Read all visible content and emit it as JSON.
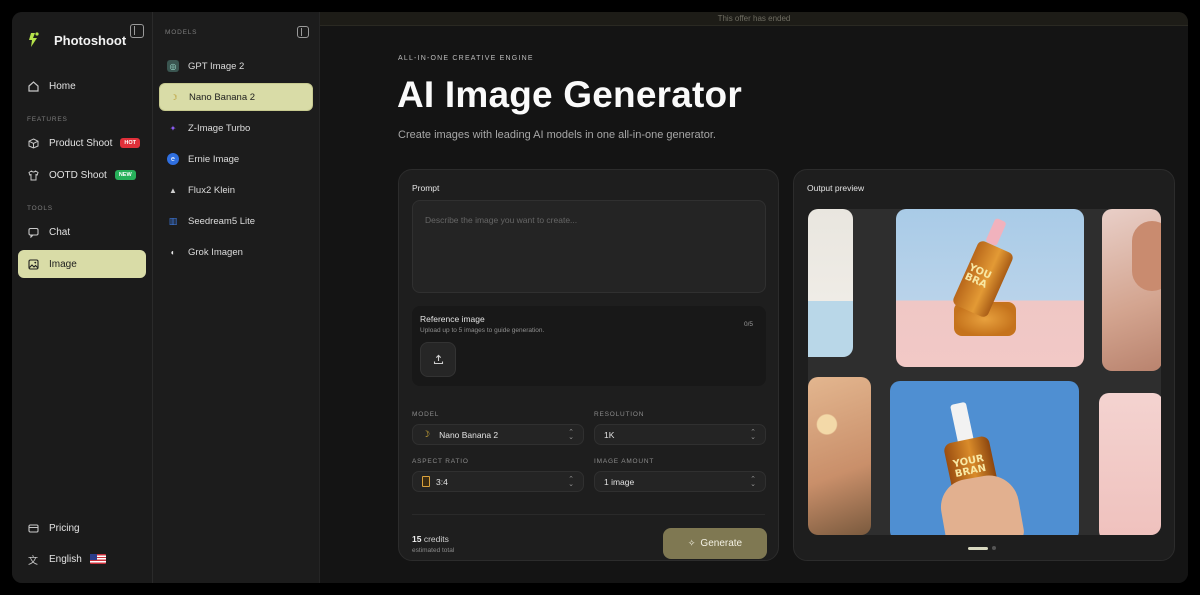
{
  "brand": {
    "name": "Photoshoot"
  },
  "nav": {
    "home": "Home",
    "features_label": "FEATURES",
    "product_shoot": "Product Shoot",
    "product_shoot_badge": "HOT",
    "ootd_shoot": "OOTD Shoot",
    "ootd_shoot_badge": "NEW",
    "tools_label": "TOOLS",
    "chat": "Chat",
    "image": "Image",
    "pricing": "Pricing",
    "language": "English"
  },
  "models_panel": {
    "header": "MODELS",
    "items": [
      {
        "label": "GPT Image 2",
        "icon": "gpt-icon"
      },
      {
        "label": "Nano Banana 2",
        "icon": "banana-icon"
      },
      {
        "label": "Z-Image Turbo",
        "icon": "z-image-icon"
      },
      {
        "label": "Ernie Image",
        "icon": "ernie-icon"
      },
      {
        "label": "Flux2 Klein",
        "icon": "flux-icon"
      },
      {
        "label": "Seedream5 Lite",
        "icon": "seedream-icon"
      },
      {
        "label": "Grok Imagen",
        "icon": "grok-icon"
      }
    ],
    "selected": "Nano Banana 2"
  },
  "offer_bar": "This offer has ended",
  "hero": {
    "eyebrow": "ALL-IN-ONE CREATIVE ENGINE",
    "title": "AI Image Generator",
    "subtitle": "Create images with leading AI models in one all-in-one generator."
  },
  "prompt_card": {
    "label": "Prompt",
    "placeholder": "Describe the image you want to create...",
    "reference": {
      "title": "Reference image",
      "subtitle": "Upload up to 5 images to guide generation.",
      "count": "0/5"
    },
    "model_label": "MODEL",
    "model_value": "Nano Banana 2",
    "resolution_label": "RESOLUTION",
    "resolution_value": "1K",
    "aspect_label": "ASPECT RATIO",
    "aspect_value": "3:4",
    "amount_label": "IMAGE AMOUNT",
    "amount_value": "1 image",
    "credits_number": "15",
    "credits_word": "credits",
    "credits_sub": "estimated total",
    "generate": "Generate"
  },
  "output_card": {
    "label": "Output preview",
    "label_bottle_1": "YOU\nBRA",
    "label_bottle_2": "YOUR\nBRAN",
    "carousel_total": 2,
    "carousel_active": 1
  },
  "colors": {
    "accent": "#d9dca7",
    "generate_button": "#7f7852",
    "hot_badge": "#e0303a",
    "new_badge": "#27b05a"
  }
}
